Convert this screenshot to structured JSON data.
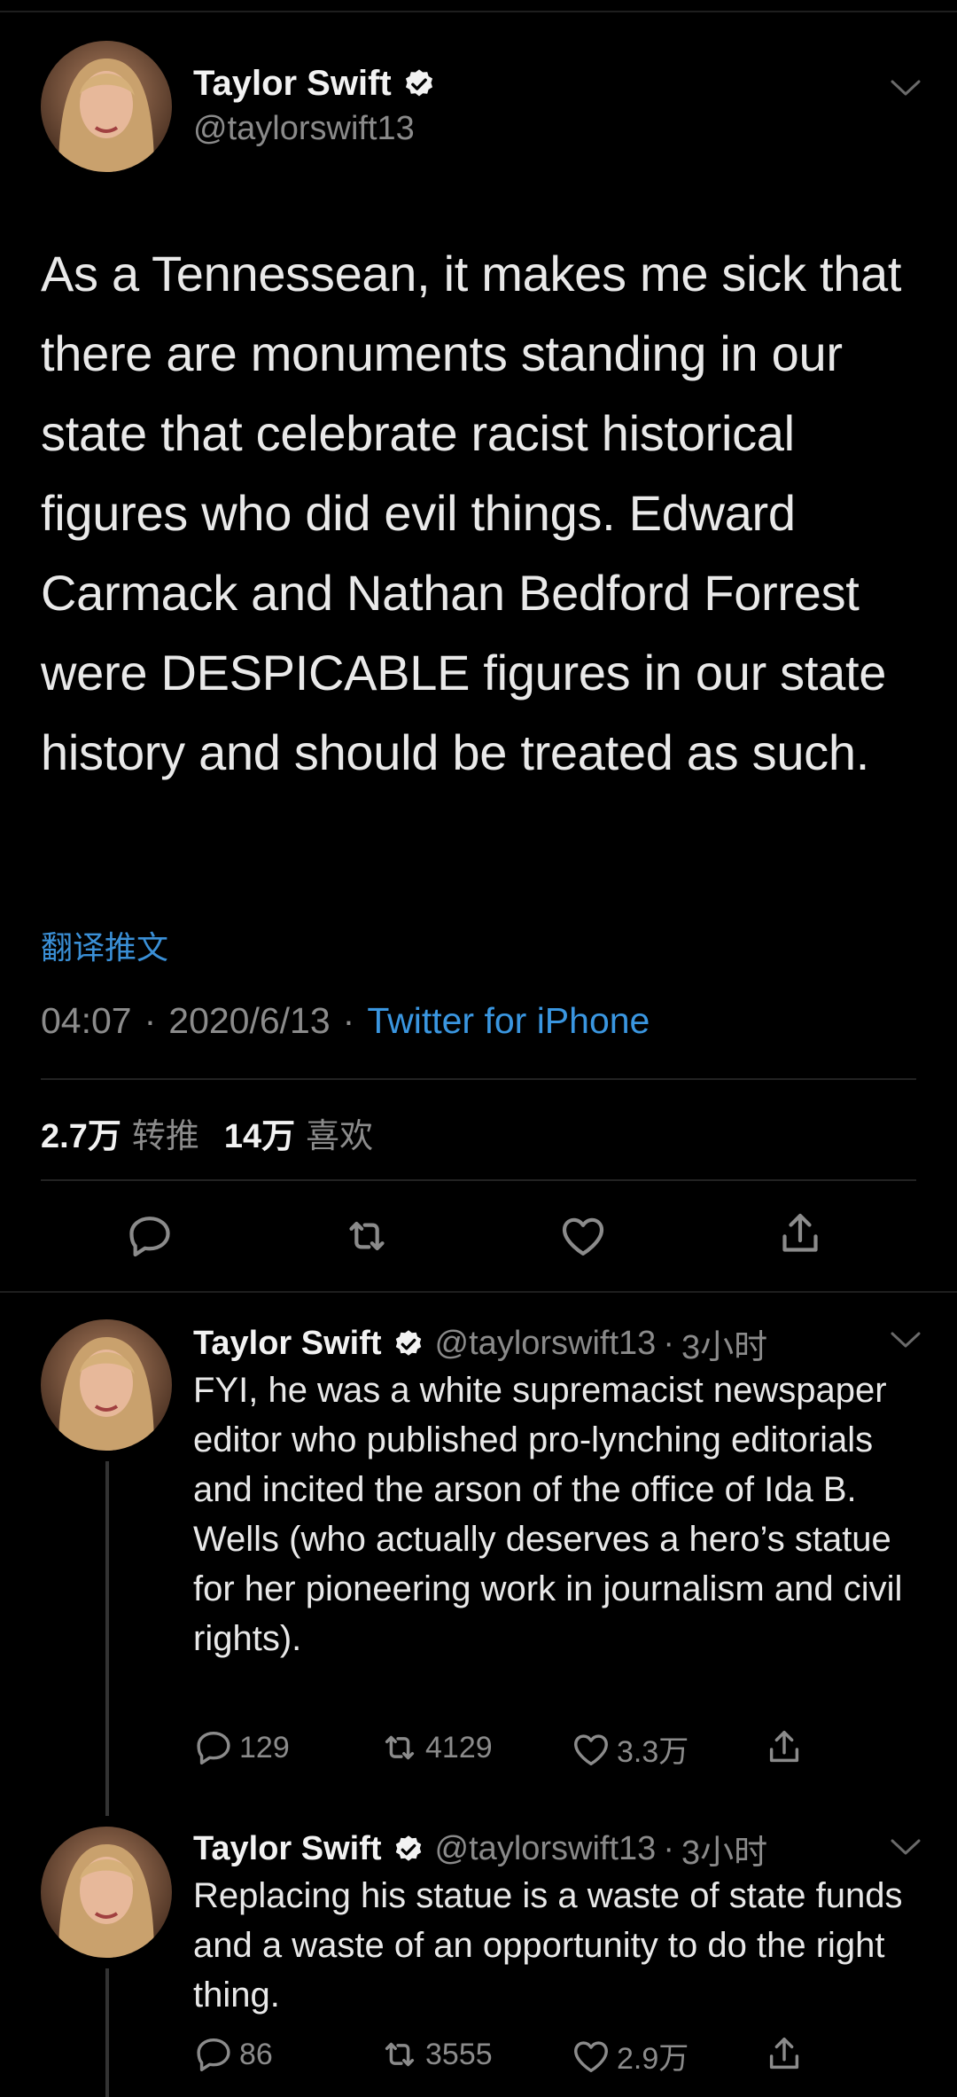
{
  "main_tweet": {
    "author_name": "Taylor Swift",
    "handle": "@taylorswift13",
    "text": "As a Tennessean, it makes me sick that there are monuments standing in our state that celebrate racist historical figures who did evil things. Edward Carmack and Nathan Bedford Forrest were DESPICABLE figures in our state history and should be treated as such.",
    "translate_label": "翻译推文",
    "time": "04:07",
    "date": "2020/6/13",
    "source": "Twitter for iPhone",
    "retweet_count": "2.7万",
    "retweet_label": "转推",
    "like_count": "14万",
    "like_label": "喜欢"
  },
  "replies": [
    {
      "author_name": "Taylor Swift",
      "handle": "@taylorswift13",
      "time": "3小时",
      "text": "FYI, he was a white supremacist newspaper editor who published pro-lynching editorials and incited the arson of the office of Ida B. Wells (who actually deserves a hero’s statue for her pioneering work in journalism and civil rights).",
      "reply_count": "129",
      "retweet_count": "4129",
      "like_count": "3.3万"
    },
    {
      "author_name": "Taylor Swift",
      "handle": "@taylorswift13",
      "time": "3小时",
      "text": "Replacing his statue is a waste of state funds and a waste of an opportunity to do the right thing.",
      "reply_count": "86",
      "retweet_count": "3555",
      "like_count": "2.9万"
    }
  ],
  "colors": {
    "background": "#000000",
    "link_blue": "#3a96e0",
    "secondary_text": "#8b8b8b",
    "verified": "#ffffff"
  },
  "icons": [
    "verified-badge-icon",
    "chevron-down-icon",
    "reply-icon",
    "retweet-icon",
    "like-icon",
    "share-icon"
  ]
}
